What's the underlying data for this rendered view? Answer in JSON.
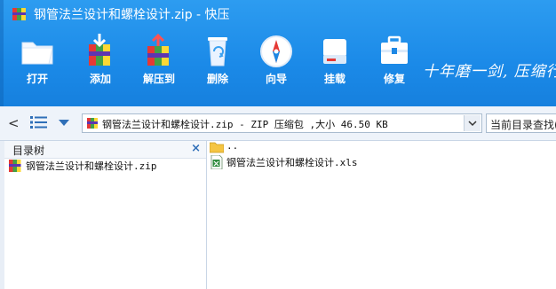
{
  "window": {
    "title": "钢管法兰设计和螺栓设计.zip - 快压"
  },
  "toolbar": {
    "items": [
      {
        "label": "打开",
        "icon": "folder-open-icon"
      },
      {
        "label": "添加",
        "icon": "add-archive-icon"
      },
      {
        "label": "解压到",
        "icon": "extract-archive-icon"
      },
      {
        "label": "删除",
        "icon": "recycle-bin-icon"
      },
      {
        "label": "向导",
        "icon": "compass-icon"
      },
      {
        "label": "挂载",
        "icon": "drive-icon"
      },
      {
        "label": "修复",
        "icon": "toolbox-icon"
      }
    ],
    "slogan": "十年磨一剑, 压缩行"
  },
  "navbar": {
    "back_glyph": "<",
    "address": "钢管法兰设计和螺栓设计.zip - ZIP 压缩包 ,大小 46.50 KB",
    "search_placeholder": "当前目录查找("
  },
  "tree": {
    "title": "目录树",
    "close_glyph": "×",
    "items": [
      {
        "label": "钢管法兰设计和螺栓设计.zip"
      }
    ]
  },
  "files": {
    "rows": [
      {
        "label": "..",
        "icon": "folder-icon"
      },
      {
        "label": "钢管法兰设计和螺栓设计.xls",
        "icon": "excel-file-icon"
      }
    ]
  },
  "colors": {
    "banner": "#1b8ae8",
    "navbar": "#eef3fa",
    "accent": "#2f6fb8"
  }
}
